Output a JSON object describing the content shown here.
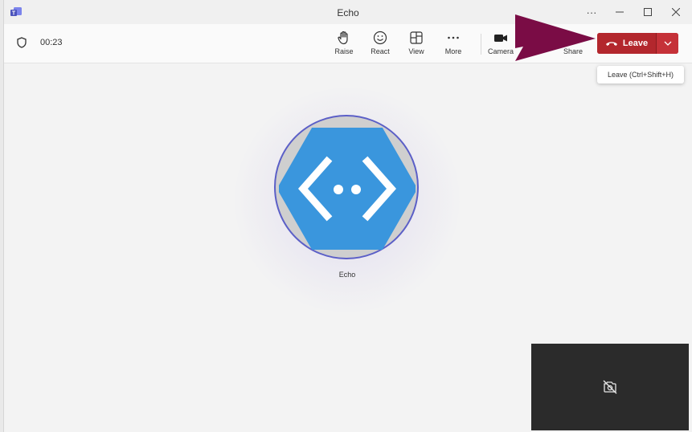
{
  "window": {
    "title": "Echo"
  },
  "call": {
    "timer": "00:23"
  },
  "toolbar": {
    "raise_label": "Raise",
    "react_label": "React",
    "view_label": "View",
    "more_label": "More",
    "camera_label": "Camera",
    "share_label": "Share",
    "leave_label": "Leave",
    "leave_tooltip": "Leave (Ctrl+Shift+H)"
  },
  "participant": {
    "name": "Echo"
  },
  "colors": {
    "leave": "#b3272d",
    "avatar": "#3a96dd",
    "ring": "#5b5fc7",
    "arrow": "#7a0c45"
  }
}
